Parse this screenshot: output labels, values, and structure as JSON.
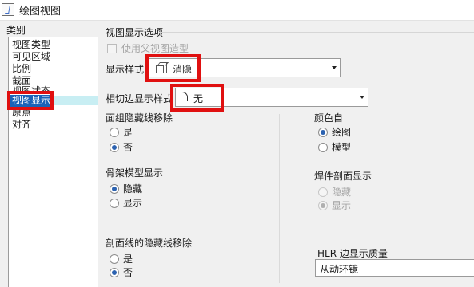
{
  "window": {
    "title": "绘图视图"
  },
  "category": {
    "label": "类别",
    "items": [
      "视图类型",
      "可见区域",
      "比例",
      "截面",
      "视图状态",
      "视图显示",
      "原点",
      "对齐"
    ],
    "selected_index": 5
  },
  "view_display": {
    "group_title": "视图显示选项",
    "use_parent_label": "使用父视图造型",
    "display_style": {
      "label": "显示样式",
      "value": "消隐",
      "icon": "cube-icon"
    },
    "tangent_edge": {
      "label": "相切边显示样式",
      "value": "无",
      "icon": "tangent-edge-icon"
    }
  },
  "face_group_hidden_removal": {
    "label": "面组隐藏线移除",
    "options": [
      "是",
      "否"
    ],
    "selected": "否"
  },
  "skeleton_display": {
    "label": "骨架模型显示",
    "options": [
      "隐藏",
      "显示"
    ],
    "selected": "隐藏"
  },
  "section_hidden_removal": {
    "label": "剖面线的隐藏线移除",
    "options": [
      "是",
      "否"
    ],
    "selected": "否"
  },
  "color_from": {
    "label": "颜色自",
    "options": [
      "绘图",
      "模型"
    ],
    "selected": "绘图"
  },
  "weld_section_display": {
    "label": "焊件剖面显示",
    "options": [
      "隐藏",
      "显示"
    ],
    "selected": "显示",
    "disabled": true
  },
  "hlr_quality": {
    "label": "HLR 边显示质量",
    "value": "从动环镜"
  },
  "colors": {
    "selection": "#1a63b8",
    "highlight": "#e01010",
    "radio_checked": "#2c62b0"
  }
}
